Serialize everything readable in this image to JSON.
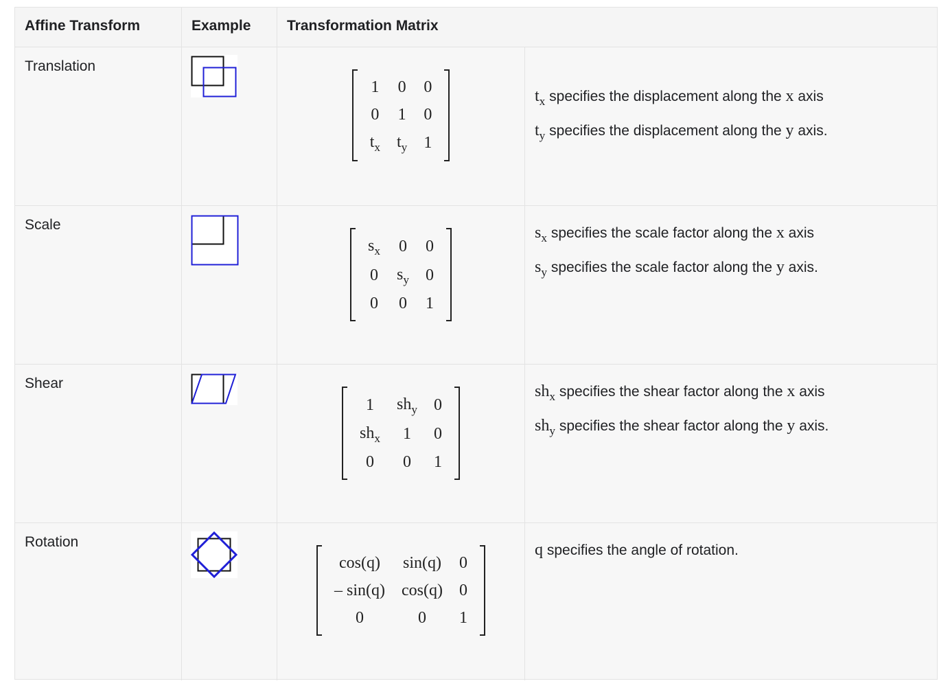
{
  "header": {
    "col1": "Affine Transform",
    "col2": "Example",
    "col3": "Transformation Matrix"
  },
  "rows": [
    {
      "name": "Translation",
      "icon": "translation-squares-icon",
      "matrix": [
        [
          "1",
          "0",
          "0"
        ],
        [
          "0",
          "1",
          "0"
        ],
        [
          "t_x",
          "t_y",
          "1"
        ]
      ],
      "desc": [
        {
          "sym": "t",
          "sub": "x",
          "text": " specifies the displacement along the ",
          "axis": "x",
          "end": " axis"
        },
        {
          "sym": "t",
          "sub": "y",
          "text": " specifies the displacement along the ",
          "axis": "y",
          "end": " axis."
        }
      ]
    },
    {
      "name": "Scale",
      "icon": "scale-squares-icon",
      "matrix": [
        [
          "s_x",
          "0",
          "0"
        ],
        [
          "0",
          "s_y",
          "0"
        ],
        [
          "0",
          "0",
          "1"
        ]
      ],
      "desc": [
        {
          "sym": "s",
          "sub": "x",
          "text": " specifies the scale factor along the ",
          "axis": "x",
          "end": " axis"
        },
        {
          "sym": "s",
          "sub": "y",
          "text": " specifies the scale factor along the ",
          "axis": "y",
          "end": " axis."
        }
      ]
    },
    {
      "name": "Shear",
      "icon": "shear-parallelogram-icon",
      "matrix": [
        [
          "1",
          "sh_y",
          "0"
        ],
        [
          "sh_x",
          "1",
          "0"
        ],
        [
          "0",
          "0",
          "1"
        ]
      ],
      "desc": [
        {
          "sym": "sh",
          "sub": "x",
          "text": " specifies the shear factor along the ",
          "axis": "x",
          "end": " axis"
        },
        {
          "sym": "sh",
          "sub": "y",
          "text": " specifies the shear factor along the ",
          "axis": "y",
          "end": " axis."
        }
      ]
    },
    {
      "name": "Rotation",
      "icon": "rotation-diamond-icon",
      "matrix": [
        [
          "cos(q)",
          "sin(q)",
          "0"
        ],
        [
          "– sin(q)",
          "cos(q)",
          "0"
        ],
        [
          "0",
          "0",
          "1"
        ]
      ],
      "desc": [
        {
          "sym": "q",
          "sub": "",
          "text": " specifies the angle of rotation.",
          "axis": "",
          "end": ""
        }
      ]
    }
  ],
  "colors": {
    "border": "#e3e3e3",
    "cell_bg": "#f7f7f7",
    "accent_blue": "#1f1fd6",
    "ink": "#222222"
  }
}
